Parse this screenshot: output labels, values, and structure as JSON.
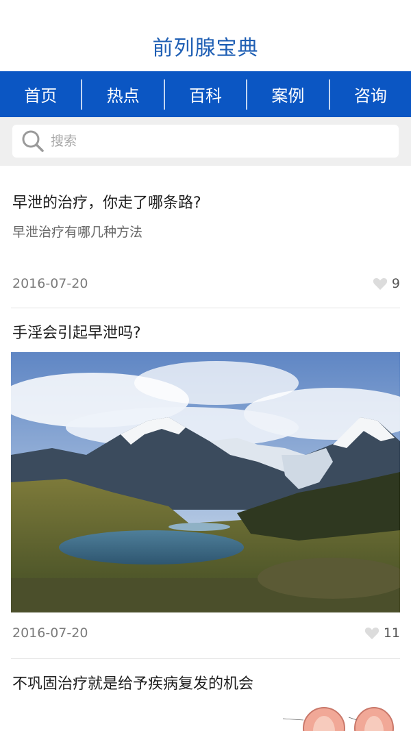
{
  "app": {
    "title": "前列腺宝典"
  },
  "nav": {
    "tabs": [
      "首页",
      "热点",
      "百科",
      "案例",
      "咨询"
    ]
  },
  "search": {
    "placeholder": "搜索"
  },
  "articles": [
    {
      "title": "早泄的治疗，你走了哪条路?",
      "summary": "早泄治疗有哪几种方法",
      "date": "2016-07-20",
      "likes": "9"
    },
    {
      "title": "手淫会引起早泄吗?",
      "date": "2016-07-20",
      "likes": "11",
      "image": "mountain-lake-photo"
    },
    {
      "title": "不巩固治疗就是给予疾病复发的机会",
      "image": "anatomy-diagram-thumbnail"
    }
  ],
  "colors": {
    "brand_blue": "#0b56c3",
    "title_blue": "#1f5fb4"
  }
}
